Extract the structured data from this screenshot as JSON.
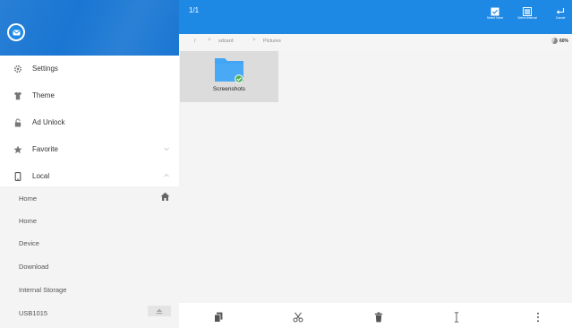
{
  "colors": {
    "primary": "#1e88e5",
    "header_dark": "#1976d2",
    "accent_green": "#4caf50",
    "folder": "#42a5f5"
  },
  "sidebar": {
    "logo_icon": "email-icon",
    "menu": [
      {
        "label": "Settings",
        "icon": "gear-icon"
      },
      {
        "label": "Theme",
        "icon": "shirt-icon"
      },
      {
        "label": "Ad Unlock",
        "icon": "lock-icon"
      },
      {
        "label": "Favorite",
        "icon": "star-icon",
        "expanded": false
      },
      {
        "label": "Local",
        "icon": "phone-icon",
        "expanded": true
      }
    ],
    "local_items": [
      {
        "label": "Home",
        "icon": "home-icon"
      },
      {
        "label": "Home"
      },
      {
        "label": "Device"
      },
      {
        "label": "Download"
      },
      {
        "label": "Internal Storage"
      },
      {
        "label": "USB1015",
        "icon": "eject-icon"
      }
    ]
  },
  "toolbar": {
    "counter": "1/1",
    "actions": [
      {
        "label": "Select None",
        "icon": "select-none-icon"
      },
      {
        "label": "Select Interval",
        "icon": "select-interval-icon"
      },
      {
        "label": "Cancel",
        "icon": "cancel-icon"
      }
    ]
  },
  "breadcrumb": {
    "items": [
      "/",
      "sdcard",
      "Pictures"
    ],
    "separator": ">",
    "storage_used": "60%"
  },
  "files": [
    {
      "name": "Screenshots",
      "type": "folder",
      "selected": true
    }
  ],
  "bottom_actions": [
    {
      "icon": "copy-icon"
    },
    {
      "icon": "cut-icon"
    },
    {
      "icon": "delete-icon"
    },
    {
      "icon": "rename-icon"
    },
    {
      "icon": "more-vert-icon"
    }
  ]
}
